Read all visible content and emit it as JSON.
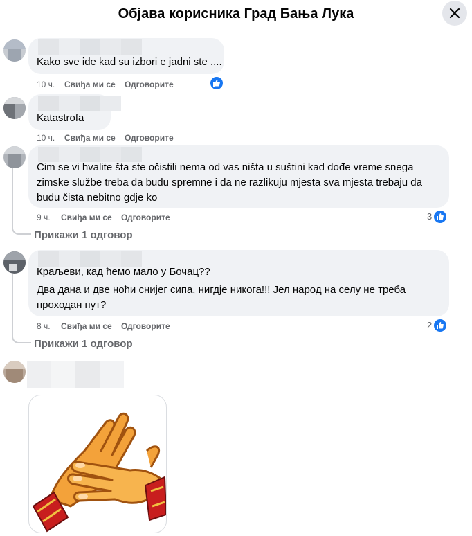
{
  "header": {
    "title": "Објава корисника Град Бања Лука"
  },
  "actions": {
    "like": "Свиђа ми се",
    "reply": "Одговорите"
  },
  "comments": [
    {
      "text": "Kako sve ide kad su izbori e jadni ste ....",
      "time": "10 ч."
    },
    {
      "text": "Katastrofa",
      "time": "10 ч."
    },
    {
      "text": "Cim se vi hvalite šta ste očistili nema od vas ništa u suštini kad dođe vreme snega zimske službe treba da budu spremne i da ne razlikuju mjesta sva mjesta trebaju da budu čista nebitno gdje ko",
      "time": "9 ч.",
      "reactions": "3",
      "show_replies": "Прикажи 1 одговор"
    },
    {
      "text_line1": "Краљеви, кад ћемо мало у Бочац??",
      "text_line2": "Два дана и две ноћи снијег сипа, нигдје никога!!! Јел народ на селу не треба проходан пут?",
      "time": "8 ч.",
      "reactions": "2",
      "show_replies": "Прикажи 1 одговор"
    },
    {
      "sticker": "clapping-hands"
    }
  ],
  "colors": {
    "accent": "#1877f2",
    "bubble": "#f0f2f5",
    "muted": "#65676b"
  }
}
